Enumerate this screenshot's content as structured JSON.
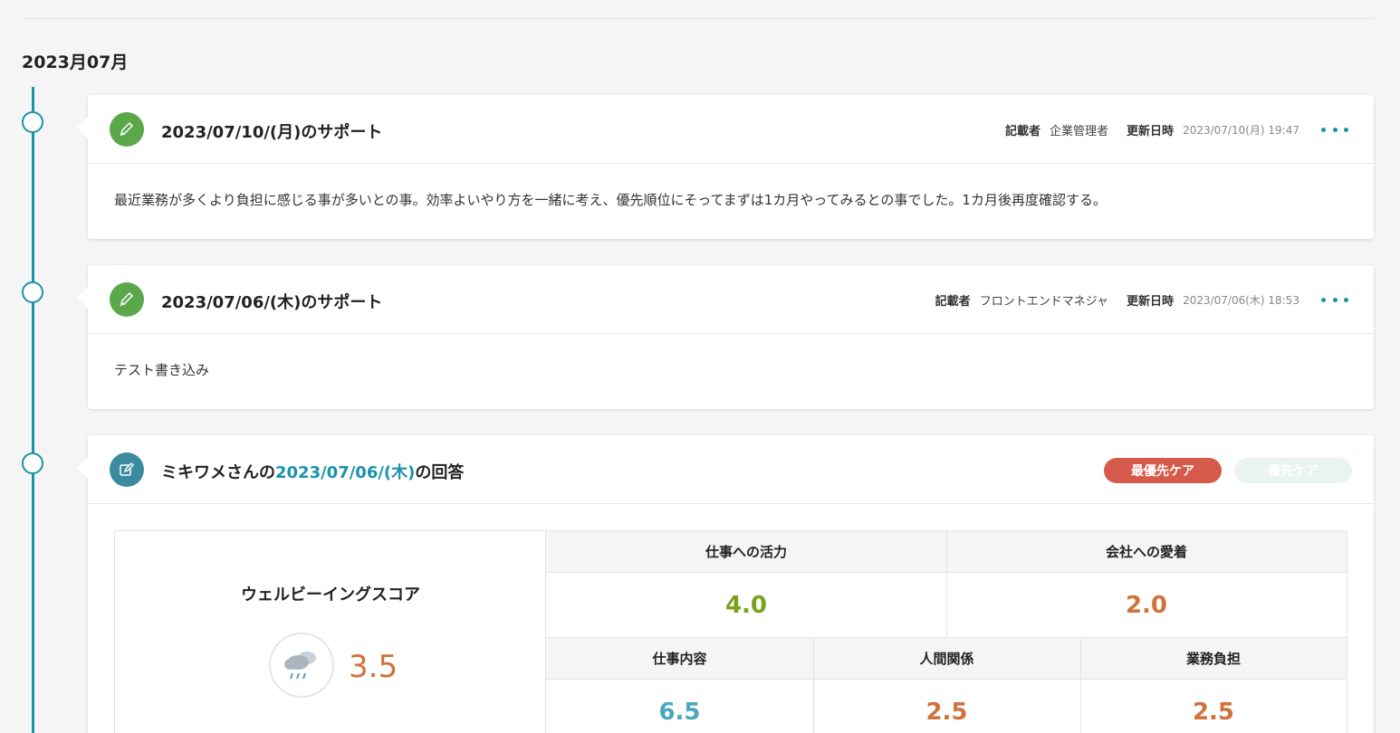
{
  "month_heading": "2023月07月",
  "entries": [
    {
      "title": "2023/07/10/(月)のサポート",
      "author_label": "記載者",
      "author": "企業管理者",
      "updated_label": "更新日時",
      "updated": "2023/07/10(月) 19:47",
      "body": "最近業務が多くより負担に感じる事が多いとの事。効率よいやり方を一緒に考え、優先順位にそってまずは1カ月やってみるとの事でした。1カ月後再度確認する。",
      "icon": "pencil-icon"
    },
    {
      "title": "2023/07/06/(木)のサポート",
      "author_label": "記載者",
      "author": "フロントエンドマネジャ",
      "updated_label": "更新日時",
      "updated": "2023/07/06(木) 18:53",
      "body": "テスト書き込み",
      "icon": "pencil-icon"
    }
  ],
  "answer": {
    "title_prefix": "ミキワメさんの",
    "title_date": "2023/07/06/(木)",
    "title_suffix": "の回答",
    "icon": "edit-icon",
    "badge_top": "最優先ケア",
    "badge_priority": "優先ケア",
    "wellbeing_label": "ウェルビーイングスコア",
    "wellbeing_icon": "rain-cloud-icon",
    "wellbeing_score": "3.5",
    "metrics_top": [
      {
        "label": "仕事への活力",
        "value": "4.0",
        "color": "#7aa31c"
      },
      {
        "label": "会社への愛着",
        "value": "2.0",
        "color": "#d0723c"
      }
    ],
    "metrics_bottom": [
      {
        "label": "仕事内容",
        "value": "6.5",
        "color": "#4aa7bd"
      },
      {
        "label": "人間関係",
        "value": "2.5",
        "color": "#d0723c"
      },
      {
        "label": "業務負担",
        "value": "2.5",
        "color": "#d0723c"
      }
    ]
  }
}
